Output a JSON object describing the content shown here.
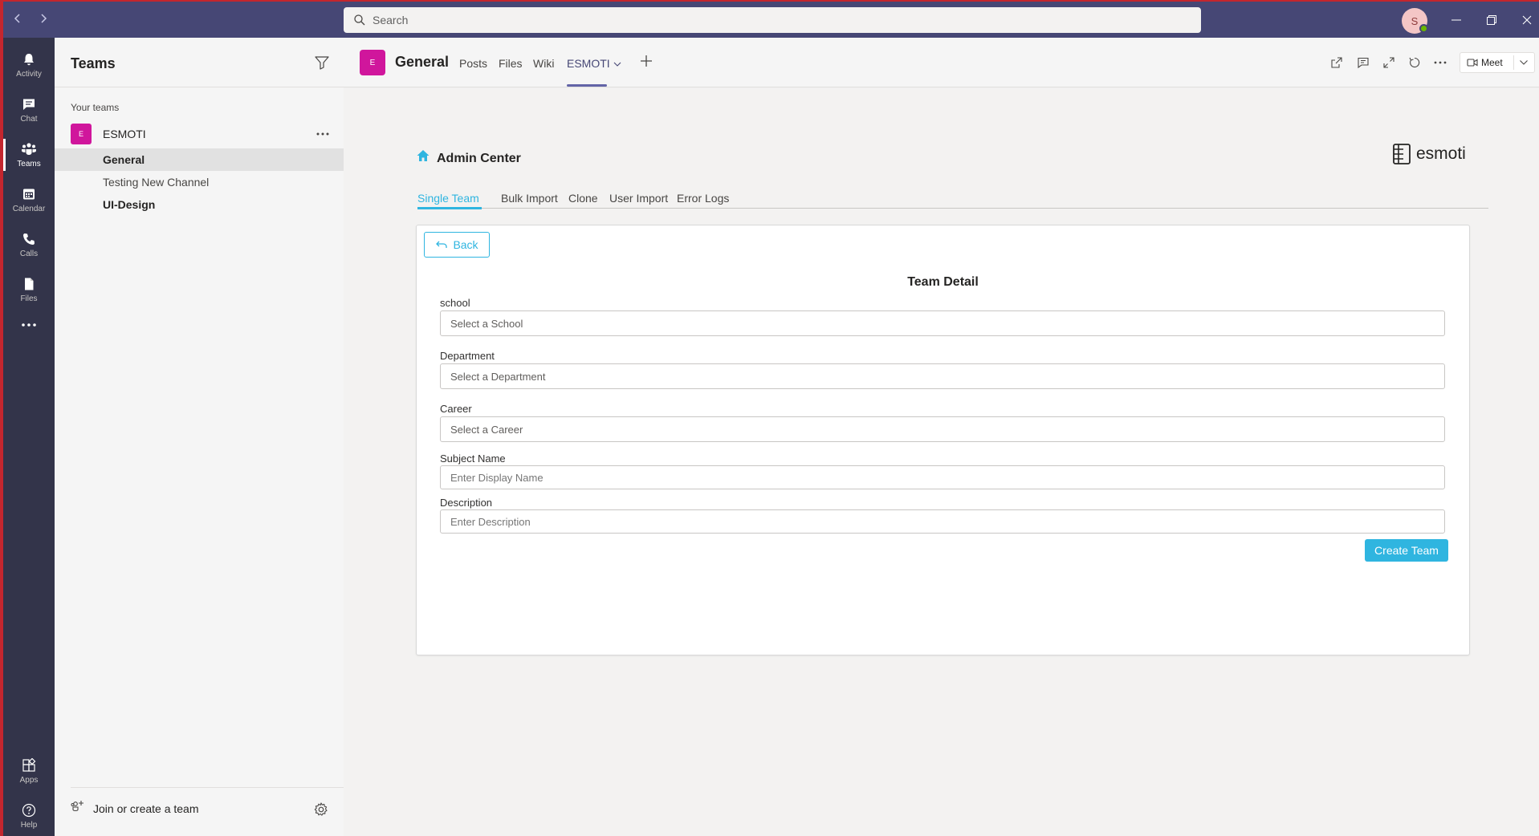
{
  "titlebar": {
    "search_placeholder": "Search",
    "avatar_initial": "S"
  },
  "rail": {
    "items": [
      {
        "label": "Activity",
        "icon": "bell-icon"
      },
      {
        "label": "Chat",
        "icon": "chat-icon"
      },
      {
        "label": "Teams",
        "icon": "teams-icon"
      },
      {
        "label": "Calendar",
        "icon": "calendar-icon"
      },
      {
        "label": "Calls",
        "icon": "phone-icon"
      },
      {
        "label": "Files",
        "icon": "file-icon"
      },
      {
        "label": "Apps",
        "icon": "apps-icon"
      },
      {
        "label": "Help",
        "icon": "help-icon"
      }
    ]
  },
  "panel": {
    "title": "Teams",
    "section_label": "Your teams",
    "team": {
      "initial": "E",
      "name": "ESMOTI"
    },
    "channels": [
      {
        "name": "General",
        "active": true,
        "bold": true
      },
      {
        "name": "Testing New Channel",
        "active": false,
        "bold": false
      },
      {
        "name": "UI-Design",
        "active": false,
        "bold": true
      }
    ],
    "join_label": "Join or create a team"
  },
  "header": {
    "avatar_initial": "E",
    "title": "General",
    "tabs": [
      "Posts",
      "Files",
      "Wiki",
      "ESMOTI"
    ],
    "active_tab": "ESMOTI",
    "meet_label": "Meet"
  },
  "admin": {
    "title": "Admin Center",
    "brand": "esmoti",
    "tabs": [
      "Single Team",
      "Bulk Import",
      "Clone",
      "User Import",
      "Error Logs"
    ],
    "active_tab": "Single Team",
    "back_label": "Back",
    "card_title": "Team Detail",
    "fields": [
      {
        "label": "school",
        "placeholder": "Select a School",
        "kind": "select"
      },
      {
        "label": "Department",
        "placeholder": "Select a Department",
        "kind": "select"
      },
      {
        "label": "Career",
        "placeholder": "Select a Career",
        "kind": "select"
      },
      {
        "label": "Subject Name",
        "placeholder": "Enter Display Name",
        "kind": "input"
      },
      {
        "label": "Description",
        "placeholder": "Enter Description",
        "kind": "input"
      }
    ],
    "submit_label": "Create Team"
  },
  "colors": {
    "titlebar": "#464775",
    "rail": "#33344a",
    "team_avatar": "#d0169c",
    "accent": "#2fb5e0",
    "teams_accent": "#6264a7"
  }
}
